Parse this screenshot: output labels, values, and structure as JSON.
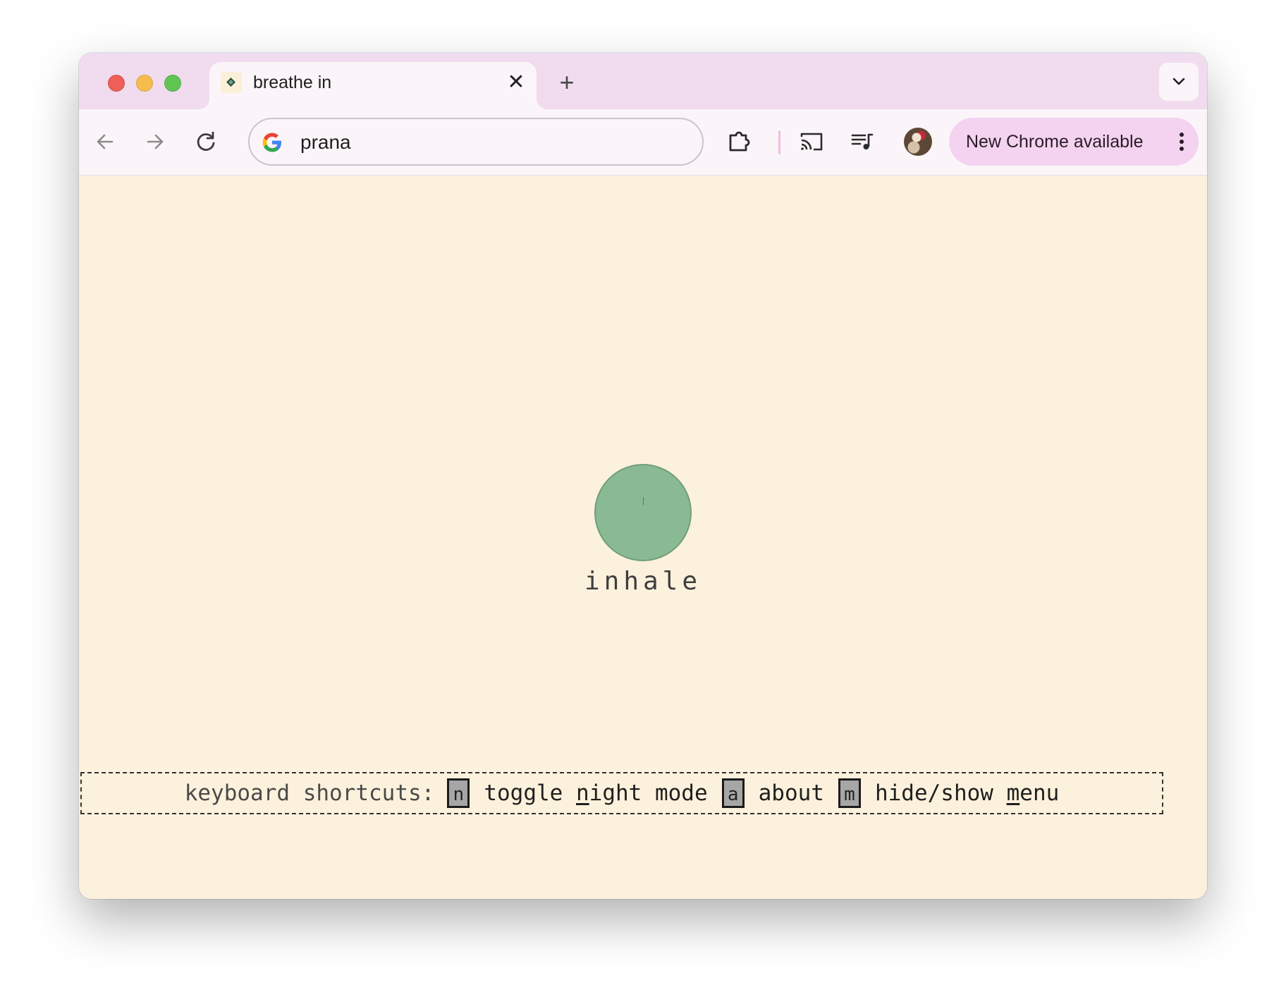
{
  "browser": {
    "tab": {
      "title": "breathe in",
      "close_glyph": "✕"
    },
    "new_tab_glyph": "+",
    "omnibox": {
      "value": "prana"
    },
    "update_button": {
      "label": "New Chrome available"
    },
    "colors": {
      "tabstrip": "#f1dbee",
      "toolbar": "#fbf5f9",
      "update_button": "#f3d3ef"
    }
  },
  "page": {
    "phase": "inhale",
    "circle_color": "#8aba94",
    "background": "#fcf1dc",
    "shortcuts": {
      "lead": "keyboard shortcuts:",
      "items": [
        {
          "key": "n",
          "before": "toggle ",
          "mnemonic": "n",
          "after": "ight mode"
        },
        {
          "key": "a",
          "before": "",
          "mnemonic": "",
          "after": "about"
        },
        {
          "key": "m",
          "before": "hide/show ",
          "mnemonic": "m",
          "after": "enu"
        }
      ]
    }
  }
}
